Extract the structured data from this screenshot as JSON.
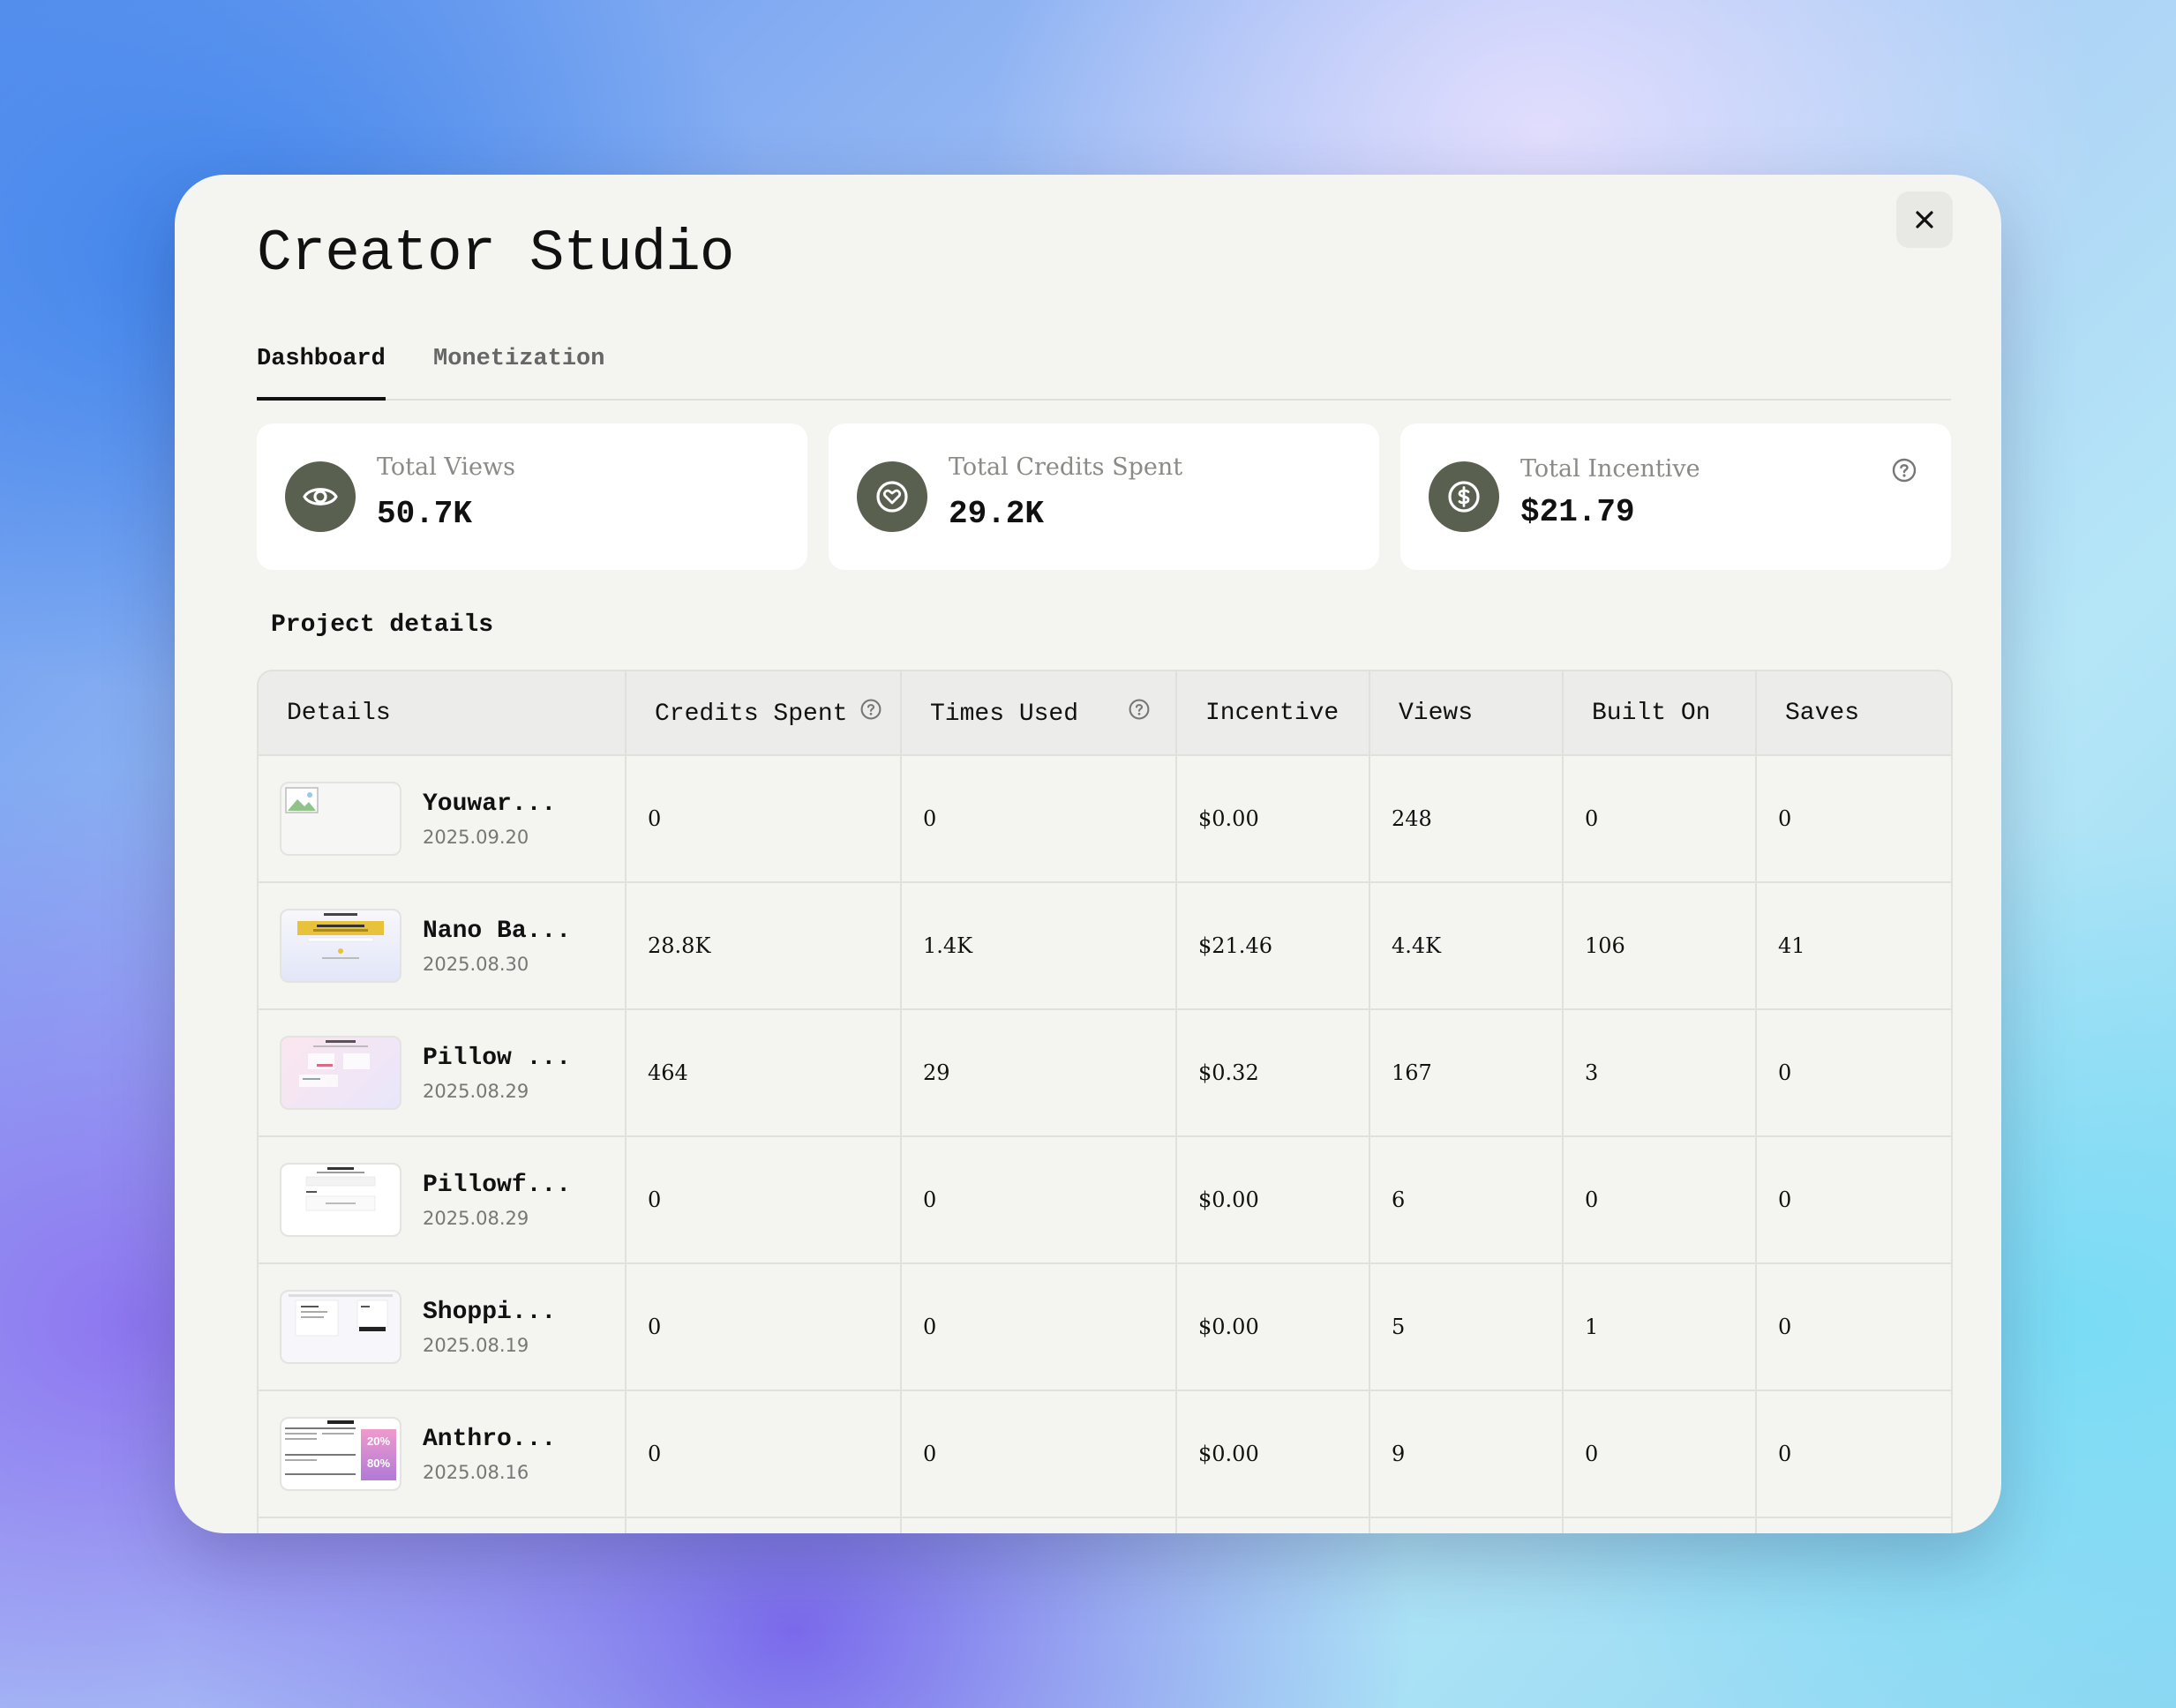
{
  "modal": {
    "title": "Creator Studio",
    "close_label": "×"
  },
  "tabs": [
    {
      "label": "Dashboard"
    },
    {
      "label": "Monetization"
    }
  ],
  "stats": [
    {
      "label": "Total Views",
      "value": "50.7K",
      "icon": "eye-icon"
    },
    {
      "label": "Total Credits Spent",
      "value": "29.2K",
      "icon": "diamond-heart-icon"
    },
    {
      "label": "Total Incentive",
      "value": "$21.79",
      "icon": "dollar-circle-icon"
    }
  ],
  "section_title": "Project details",
  "table": {
    "columns": [
      "Details",
      "Credits Spent",
      "Times Used",
      "Incentive",
      "Views",
      "Built On",
      "Saves"
    ],
    "rows": [
      {
        "name": "Youwar...",
        "date": "2025.09.20",
        "credits": "0",
        "times_used": "0",
        "incentive": "$0.00",
        "views": "248",
        "built_on": "0",
        "saves": "0",
        "thumb": "broken-image"
      },
      {
        "name": "Nano Ba...",
        "date": "2025.08.30",
        "credits": "28.8K",
        "times_used": "1.4K",
        "incentive": "$21.46",
        "views": "4.4K",
        "built_on": "106",
        "saves": "41",
        "thumb": "yellow-banner"
      },
      {
        "name": "Pillow ...",
        "date": "2025.08.29",
        "credits": "464",
        "times_used": "29",
        "incentive": "$0.32",
        "views": "167",
        "built_on": "3",
        "saves": "0",
        "thumb": "pink-page"
      },
      {
        "name": "Pillowf...",
        "date": "2025.08.29",
        "credits": "0",
        "times_used": "0",
        "incentive": "$0.00",
        "views": "6",
        "built_on": "0",
        "saves": "0",
        "thumb": "white-form"
      },
      {
        "name": "Shoppi...",
        "date": "2025.08.19",
        "credits": "0",
        "times_used": "0",
        "incentive": "$0.00",
        "views": "5",
        "built_on": "1",
        "saves": "0",
        "thumb": "shopping-page"
      },
      {
        "name": "Anthro...",
        "date": "2025.08.16",
        "credits": "0",
        "times_used": "0",
        "incentive": "$0.00",
        "views": "9",
        "built_on": "0",
        "saves": "0",
        "thumb": "promo-page"
      }
    ]
  },
  "thumb_text": {
    "promo_a": "20%",
    "promo_b": "80%"
  },
  "colors": {
    "accent_dark": "#111111",
    "icon_bg": "#596050",
    "modal_bg": "#f4f4f0",
    "card_bg": "#ffffff"
  }
}
